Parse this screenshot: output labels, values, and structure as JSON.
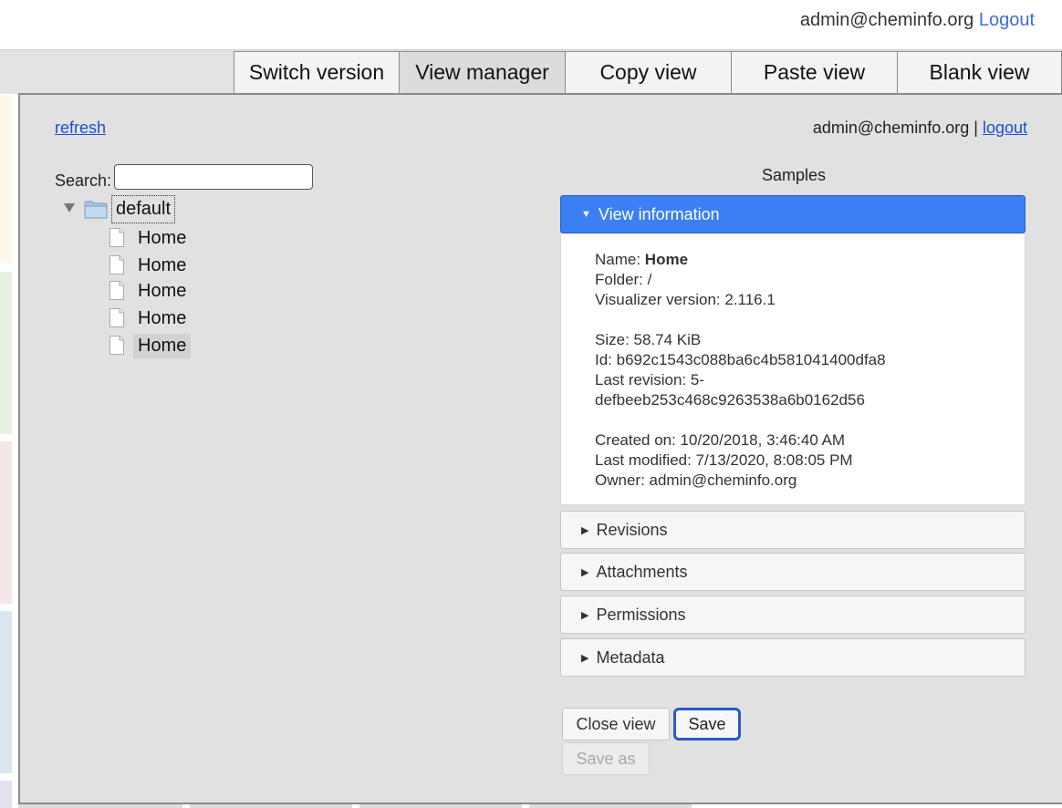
{
  "topbar": {
    "user_email": "admin@cheminfo.org",
    "logout_label": "Logout"
  },
  "toolbar": {
    "tabs": [
      {
        "label": "Switch version"
      },
      {
        "label": "View manager"
      },
      {
        "label": "Copy view"
      },
      {
        "label": "Paste view"
      },
      {
        "label": "Blank view"
      }
    ]
  },
  "panel": {
    "refresh_label": "refresh",
    "user_email": "admin@cheminfo.org",
    "separator": "|",
    "logout_label": "logout",
    "search_label": "Search:",
    "search_value": "",
    "tree": {
      "root_label": "default",
      "items": [
        {
          "label": "Home"
        },
        {
          "label": "Home"
        },
        {
          "label": "Home"
        },
        {
          "label": "Home"
        },
        {
          "label": "Home"
        }
      ]
    },
    "samples_title": "Samples",
    "accordion": {
      "view_information": "View information",
      "revisions": "Revisions",
      "attachments": "Attachments",
      "permissions": "Permissions",
      "metadata": "Metadata"
    },
    "info": {
      "name_label": "Name: ",
      "name_value": "Home",
      "folder": "Folder: /",
      "visualizer_version": "Visualizer version: 2.116.1",
      "size": "Size: 58.74 KiB",
      "id": "Id: b692c1543c088ba6c4b581041400dfa8",
      "last_revision_1": "Last revision: 5-",
      "last_revision_2": "defbeeb253c468c9263538a6b0162d56",
      "created_on": "Created on: 10/20/2018, 3:46:40 AM",
      "last_modified": "Last modified: 7/13/2020, 8:08:05 PM",
      "owner": "Owner: admin@cheminfo.org"
    },
    "buttons": {
      "close_view": "Close view",
      "save": "Save",
      "save_as": "Save as"
    }
  },
  "colors": {
    "accent": "#3b7ff3",
    "link": "#1a4fd6",
    "panel_bg": "#e1e1e1",
    "strip_yellow": "#fdf8e8",
    "strip_green": "#e6f1e2",
    "strip_pink": "#f5e6e8",
    "strip_blue": "#dce6f3"
  }
}
